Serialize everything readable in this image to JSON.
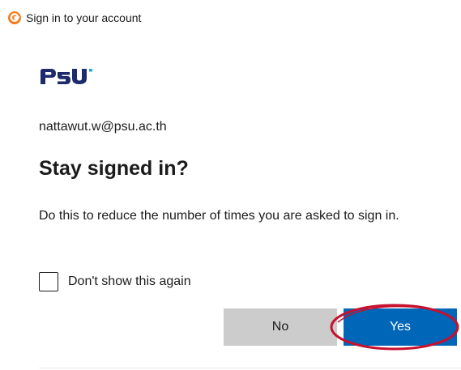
{
  "window": {
    "title": "Sign in to your account",
    "icon": "app-logo-icon"
  },
  "brand": {
    "logo_text": "PSU",
    "logo_color": "#1d2a6b"
  },
  "account": {
    "email": "nattawut.w@psu.ac.th"
  },
  "prompt": {
    "heading": "Stay signed in?",
    "description": "Do this to reduce the number of times you are asked to sign in."
  },
  "checkbox": {
    "label": "Don't show this again",
    "checked": false
  },
  "buttons": {
    "no_label": "No",
    "yes_label": "Yes"
  },
  "colors": {
    "primary": "#0067b8",
    "secondary": "#cccccc",
    "annotation": "#c8102e"
  }
}
